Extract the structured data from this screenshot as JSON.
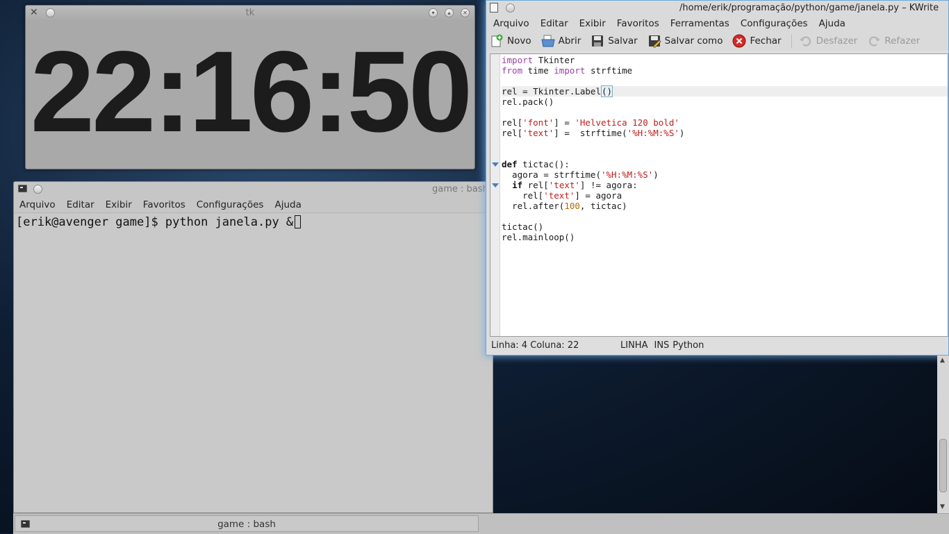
{
  "tk_window": {
    "title": "tk",
    "clock": "22:16:50"
  },
  "terminal": {
    "title": "game : bash",
    "menu": [
      "Arquivo",
      "Editar",
      "Exibir",
      "Favoritos",
      "Configurações",
      "Ajuda"
    ],
    "prompt": "[erik@avenger game]$ python janela.py &"
  },
  "kwrite": {
    "title": "/home/erik/programação/python/game/janela.py – KWrite",
    "menu": [
      "Arquivo",
      "Editar",
      "Exibir",
      "Favoritos",
      "Ferramentas",
      "Configurações",
      "Ajuda"
    ],
    "toolbar": {
      "new": "Novo",
      "open": "Abrir",
      "save": "Salvar",
      "save_as": "Salvar como",
      "close": "Fechar",
      "undo": "Desfazer",
      "redo": "Refazer"
    },
    "status": {
      "position": "Linha: 4 Coluna: 22",
      "mode": "LINHA",
      "ins": "INS",
      "syntax": "Python"
    }
  },
  "code_lines": [
    "import Tkinter",
    "from time import strftime",
    "",
    "rel = Tkinter.Label()",
    "rel.pack()",
    "",
    "rel['font'] = 'Helvetica 120 bold'",
    "rel['text'] =  strftime('%H:%M:%S')",
    "",
    "",
    "def tictac():",
    "  agora = strftime('%H:%M:%S')",
    "  if rel['text'] != agora:",
    "    rel['text'] = agora",
    "  rel.after(100, tictac)",
    "",
    "tictac()",
    "rel.mainloop()"
  ],
  "taskbar": {
    "item_label": "game : bash"
  },
  "colors": {
    "keyword": "#9a3fa5",
    "string": "#bf1d1d",
    "number": "#b06a00",
    "focus_glow": "#6fa7d6"
  },
  "icons": {
    "new": "new-document-icon",
    "open": "open-folder-icon",
    "save": "floppy-icon",
    "save_as": "save-as-icon",
    "close": "close-red-icon",
    "undo": "undo-icon",
    "redo": "redo-icon"
  }
}
